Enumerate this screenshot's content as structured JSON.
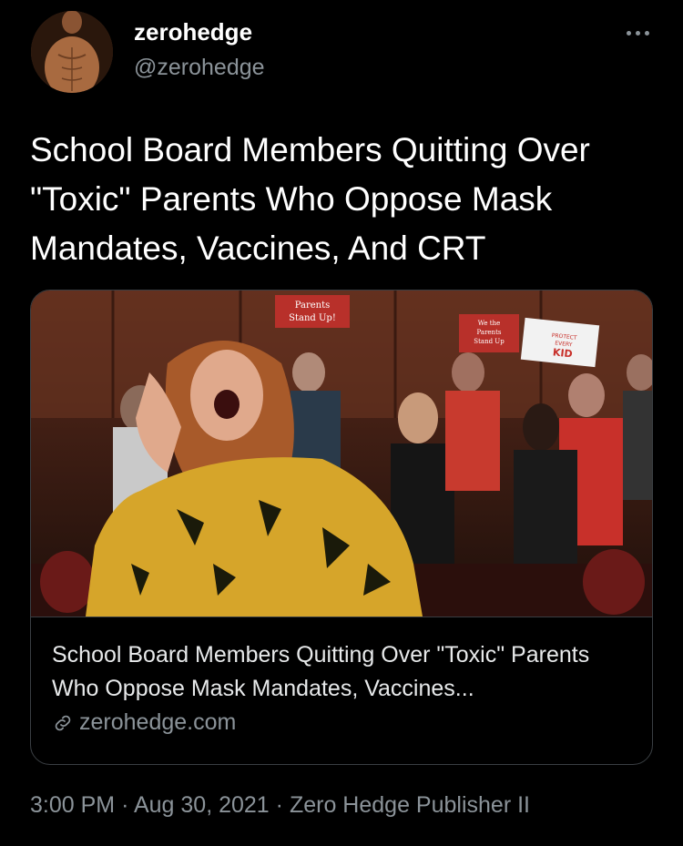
{
  "author": {
    "display_name": "zerohedge",
    "handle": "@zerohedge"
  },
  "tweet": {
    "text": "School Board Members Quitting Over \"Toxic\" Parents Who Oppose Mask Mandates, Vaccines, And CRT"
  },
  "card": {
    "title": "School Board Members Quitting Over \"Toxic\" Parents Who Oppose Mask Mandates, Vaccines...",
    "domain": "zerohedge.com",
    "image_signs": {
      "sign_1": "Parents Stand Up!",
      "sign_2": "We the Parents Stand Up",
      "sign_3": "PROTECT EVERY KID"
    }
  },
  "meta": {
    "time": "3:00 PM",
    "separator": "·",
    "date": "Aug 30, 2021",
    "source": "Zero Hedge Publisher II"
  },
  "icons": {
    "more": "more-horizontal-icon",
    "link": "link-icon"
  },
  "colors": {
    "background": "#000000",
    "text_primary": "#ffffff",
    "text_secondary": "#8b9399",
    "border": "#3a3f43"
  }
}
